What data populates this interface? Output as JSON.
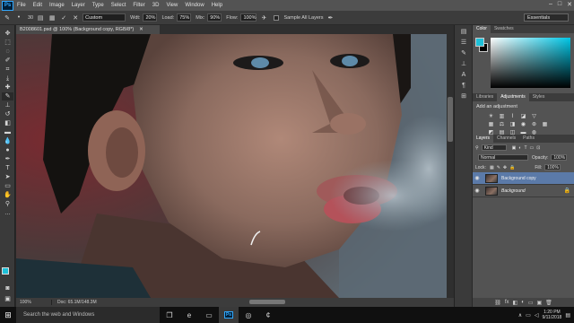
{
  "app": {
    "logo": "Ps"
  },
  "menu": [
    "File",
    "Edit",
    "Image",
    "Layer",
    "Type",
    "Select",
    "Filter",
    "3D",
    "View",
    "Window",
    "Help"
  ],
  "options_bar": {
    "brush_size": "30",
    "preset": "Custom",
    "width_label": "Wdt:",
    "width_value": "20%",
    "load_label": "Load:",
    "load_value": "75%",
    "mix_label": "Mix:",
    "mix_value": "90%",
    "flow_label": "Flow:",
    "flow_value": "100%",
    "sample_all_layers": "Sample All Layers",
    "workspace": "Essentials"
  },
  "document": {
    "tab_title": "B2008601.psd @ 100% (Background copy, RGB/8*)",
    "zoom": "100%",
    "doc_size": "Doc: 65.1M/148.3M"
  },
  "colors": {
    "foreground": "#1ec0d8",
    "background": "#000000",
    "accent": "#31a8ff"
  },
  "panels": {
    "color_tabs": [
      "Color",
      "Swatches"
    ],
    "mid_tabs": [
      "Libraries",
      "Adjustments",
      "Styles"
    ],
    "adjust_title": "Add an adjustment",
    "layers_tabs": [
      "Layers",
      "Channels",
      "Paths"
    ],
    "kind_label": "Kind",
    "blend_mode": "Normal",
    "opacity_label": "Opacity:",
    "opacity_value": "100%",
    "lock_label": "Lock:",
    "fill_label": "Fill:",
    "fill_value": "100%",
    "layers": [
      {
        "name": "Background copy",
        "selected": true
      },
      {
        "name": "Background",
        "selected": false
      }
    ]
  },
  "taskbar": {
    "search_placeholder": "Search the web and Windows",
    "time": "1:20 PM",
    "date": "9/11/2018"
  }
}
